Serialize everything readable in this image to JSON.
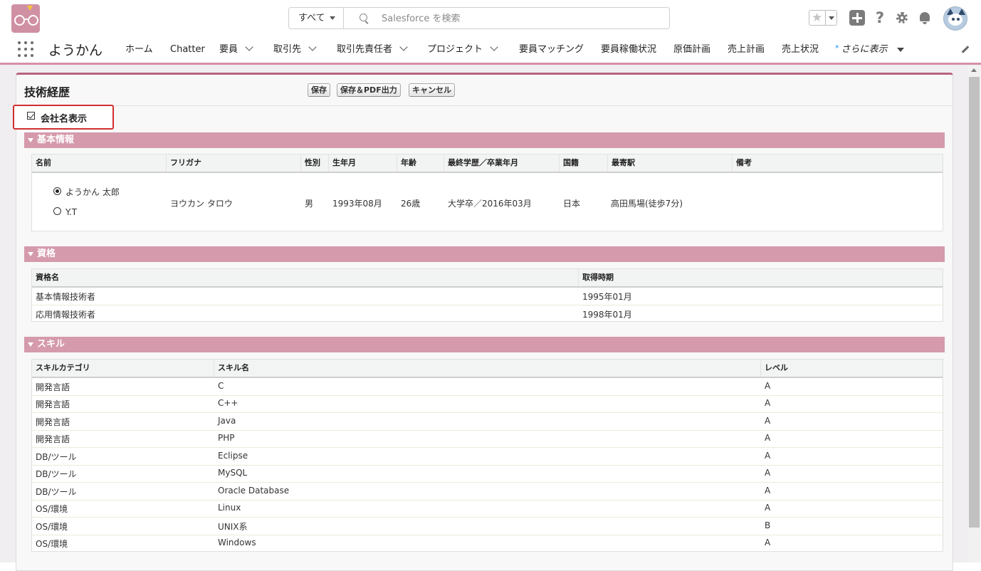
{
  "header": {
    "search_scope": "すべて",
    "search_placeholder": "Salesforce を検索"
  },
  "nav": {
    "app_name": "ようかん",
    "items": [
      {
        "label": "ホーム",
        "dropdown": false
      },
      {
        "label": "Chatter",
        "dropdown": false
      },
      {
        "label": "要員",
        "dropdown": true
      },
      {
        "label": "取引先",
        "dropdown": true
      },
      {
        "label": "取引先責任者",
        "dropdown": true
      },
      {
        "label": "プロジェクト",
        "dropdown": true
      },
      {
        "label": "要員マッチング",
        "dropdown": false
      },
      {
        "label": "要員稼働状況",
        "dropdown": false
      },
      {
        "label": "原価計画",
        "dropdown": false
      },
      {
        "label": "売上計画",
        "dropdown": false
      },
      {
        "label": "売上状況",
        "dropdown": false
      }
    ],
    "more_label": "さらに表示"
  },
  "page": {
    "title": "技術経歴",
    "buttons": {
      "save": "保存",
      "save_pdf": "保存＆PDF出力",
      "cancel": "キャンセル"
    },
    "company_checkbox": {
      "label": "会社名表示",
      "checked": true
    }
  },
  "basic": {
    "section_title": "基本情報",
    "headers": [
      "名前",
      "フリガナ",
      "性別",
      "生年月",
      "年齢",
      "最終学歴／卒業年月",
      "国籍",
      "最寄駅",
      "備考"
    ],
    "name_options": [
      {
        "label": "ようかん 太郎",
        "selected": true
      },
      {
        "label": "Y.T",
        "selected": false
      }
    ],
    "furigana": "ヨウカン タロウ",
    "gender": "男",
    "birth": "1993年08月",
    "age": "26歳",
    "education": "大学卒／2016年03月",
    "nationality": "日本",
    "station": "高田馬場(徒歩7分)",
    "note": ""
  },
  "qualifications": {
    "section_title": "資格",
    "headers": [
      "資格名",
      "取得時期"
    ],
    "rows": [
      [
        "基本情報技術者",
        "1995年01月"
      ],
      [
        "応用情報技術者",
        "1998年01月"
      ]
    ]
  },
  "skills": {
    "section_title": "スキル",
    "headers": [
      "スキルカテゴリ",
      "スキル名",
      "レベル"
    ],
    "rows": [
      [
        "開発言語",
        "C",
        "A"
      ],
      [
        "開発言語",
        "C++",
        "A"
      ],
      [
        "開発言語",
        "Java",
        "A"
      ],
      [
        "開発言語",
        "PHP",
        "A"
      ],
      [
        "DB/ツール",
        "Eclipse",
        "A"
      ],
      [
        "DB/ツール",
        "MySQL",
        "A"
      ],
      [
        "DB/ツール",
        "Oracle Database",
        "A"
      ],
      [
        "OS/環境",
        "Linux",
        "A"
      ],
      [
        "OS/環境",
        "UNIX系",
        "B"
      ],
      [
        "OS/環境",
        "Windows",
        "A"
      ]
    ]
  }
}
